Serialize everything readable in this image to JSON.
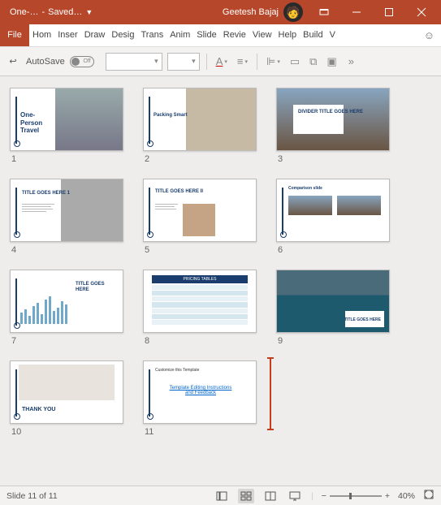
{
  "titlebar": {
    "doc_name": "One-…",
    "save_status": "Saved…",
    "user_name": "Geetesh Bajaj"
  },
  "ribbon_tabs": [
    "File",
    "Hom",
    "Inser",
    "Draw",
    "Desig",
    "Trans",
    "Anim",
    "Slide",
    "Revie",
    "View",
    "Help",
    "Build",
    "V"
  ],
  "ribbonbar": {
    "autosave_label": "AutoSave",
    "autosave_state": "Off"
  },
  "slides": [
    {
      "title": "One-Person Travel"
    },
    {
      "title": "Packing Smart"
    },
    {
      "title": "DIVIDER TITLE GOES HERE"
    },
    {
      "title": "TITLE GOES HERE 1"
    },
    {
      "title": "TITLE GOES HERE II"
    },
    {
      "title": "Comparison slide"
    },
    {
      "title": "TITLE GOES HERE"
    },
    {
      "title": "PRICING TABLES"
    },
    {
      "title": "TITLE GOES HERE"
    },
    {
      "title": "THANK YOU"
    },
    {
      "title": "Customize this Template",
      "link": "Template Editing Instructions and Feedback"
    }
  ],
  "chart_data": {
    "type": "bar",
    "title": "TITLE GOES HERE",
    "values": [
      14,
      18,
      10,
      22,
      26,
      12,
      30,
      34,
      16,
      20,
      28,
      24
    ],
    "ylim": [
      0,
      40
    ]
  },
  "statusbar": {
    "slide_count": "Slide 11 of 11",
    "zoom": "40%"
  }
}
